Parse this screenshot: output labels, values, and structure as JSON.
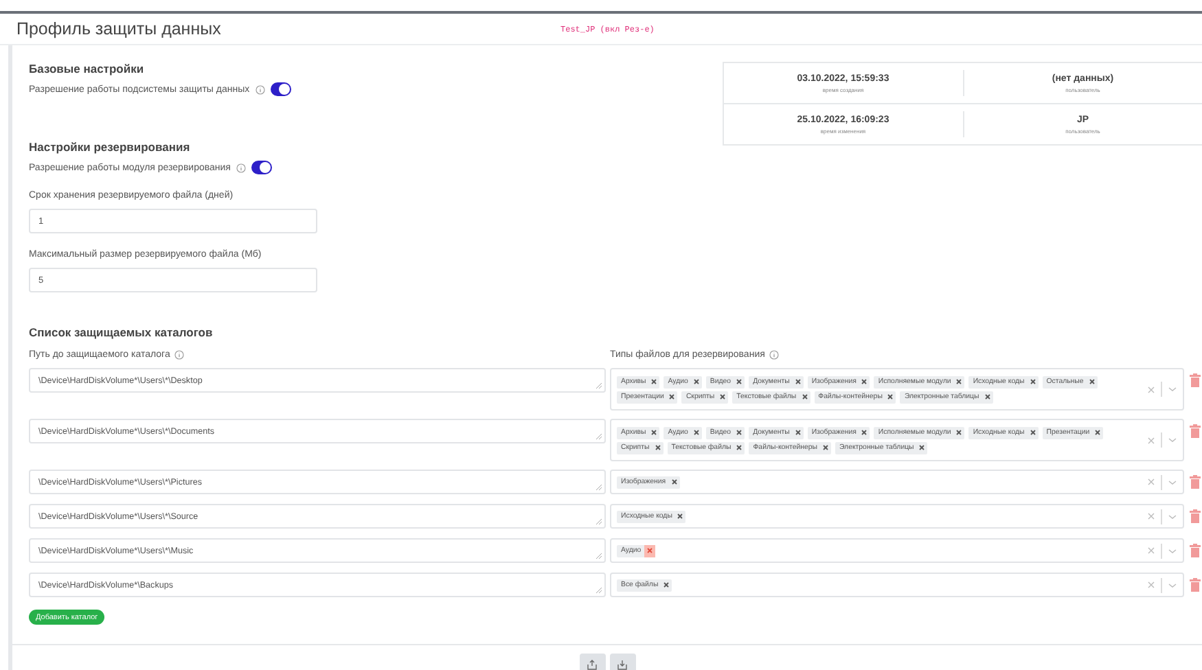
{
  "header": {
    "title": "Профиль защиты данных",
    "profile_tag": "Test_JP (вкл Рез-е)"
  },
  "base_settings": {
    "heading": "Базовые настройки",
    "toggle": {
      "label": "Разрешение работы подсистемы защиты данных",
      "on": true
    }
  },
  "info": [
    {
      "value": "03.10.2022, 15:59:33",
      "caption": "время создания",
      "user": "(нет данных)",
      "user_caption": "пользователь"
    },
    {
      "value": "25.10.2022, 16:09:23",
      "caption": "время изменения",
      "user": "JP",
      "user_caption": "пользователь"
    }
  ],
  "backup_settings": {
    "heading": "Настройки резервирования",
    "toggle": {
      "label": "Разрешение работы модуля резервирования",
      "on": true
    },
    "fields": [
      {
        "label": "Срок хранения резервируемого файла (дней)",
        "value": "1"
      },
      {
        "label": "Максимальный размер резервируемого файла (Мб)",
        "value": "5"
      }
    ]
  },
  "catalogs": {
    "heading": "Список защищаемых каталогов",
    "path_label": "Путь до защищаемого каталога",
    "types_label": "Типы файлов для резервирования",
    "rows": [
      {
        "path": "\\Device\\HardDiskVolume*\\Users\\*\\Desktop",
        "tags": [
          {
            "label": "Архивы",
            "remove_hovered": false
          },
          {
            "label": "Аудио",
            "remove_hovered": false
          },
          {
            "label": "Видео",
            "remove_hovered": false
          },
          {
            "label": "Документы",
            "remove_hovered": false
          },
          {
            "label": "Изображения",
            "remove_hovered": false
          },
          {
            "label": "Исполняемые модули",
            "remove_hovered": false
          },
          {
            "label": "Исходные коды",
            "remove_hovered": false
          },
          {
            "label": "Остальные",
            "remove_hovered": false
          },
          {
            "label": "Презентации",
            "remove_hovered": false
          },
          {
            "label": "Скрипты",
            "remove_hovered": false
          },
          {
            "label": "Текстовые файлы",
            "remove_hovered": false
          },
          {
            "label": "Файлы-контейнеры",
            "remove_hovered": false
          },
          {
            "label": "Электронные таблицы",
            "remove_hovered": false
          }
        ]
      },
      {
        "path": "\\Device\\HardDiskVolume*\\Users\\*\\Documents",
        "tags": [
          {
            "label": "Архивы",
            "remove_hovered": false
          },
          {
            "label": "Аудио",
            "remove_hovered": false
          },
          {
            "label": "Видео",
            "remove_hovered": false
          },
          {
            "label": "Документы",
            "remove_hovered": false
          },
          {
            "label": "Изображения",
            "remove_hovered": false
          },
          {
            "label": "Исполняемые модули",
            "remove_hovered": false
          },
          {
            "label": "Исходные коды",
            "remove_hovered": false
          },
          {
            "label": "Презентации",
            "remove_hovered": false
          },
          {
            "label": "Скрипты",
            "remove_hovered": false
          },
          {
            "label": "Текстовые файлы",
            "remove_hovered": false
          },
          {
            "label": "Файлы-контейнеры",
            "remove_hovered": false
          },
          {
            "label": "Электронные таблицы",
            "remove_hovered": false
          }
        ]
      },
      {
        "path": "\\Device\\HardDiskVolume*\\Users\\*\\Pictures",
        "tags": [
          {
            "label": "Изображения",
            "remove_hovered": false
          }
        ]
      },
      {
        "path": "\\Device\\HardDiskVolume*\\Users\\*\\Source",
        "tags": [
          {
            "label": "Исходные коды",
            "remove_hovered": false
          }
        ]
      },
      {
        "path": "\\Device\\HardDiskVolume*\\Users\\*\\Music",
        "tags": [
          {
            "label": "Аудио",
            "remove_hovered": true
          }
        ]
      },
      {
        "path": "\\Device\\HardDiskVolume*\\Backups",
        "tags": [
          {
            "label": "Все файлы",
            "remove_hovered": false
          }
        ]
      }
    ],
    "add_button": "Добавить каталог"
  }
}
